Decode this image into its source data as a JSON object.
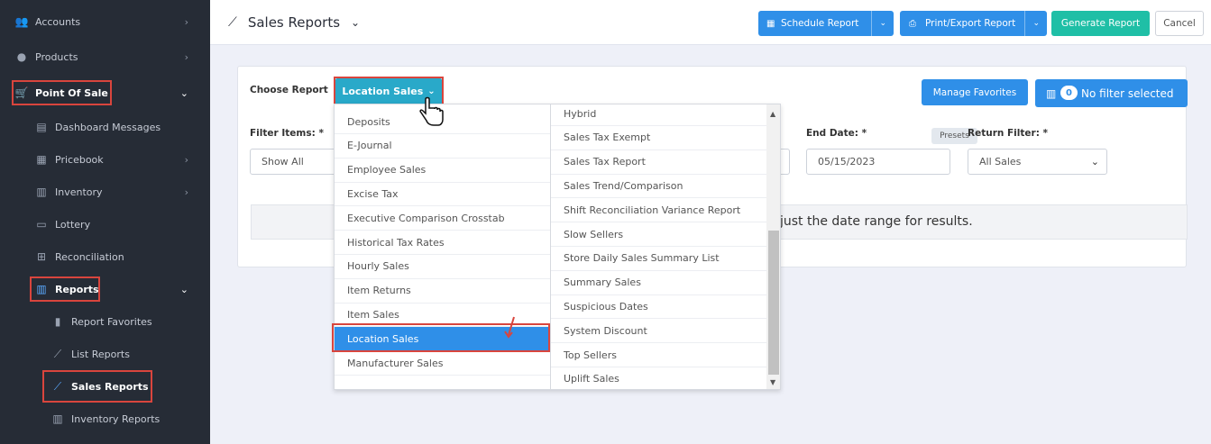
{
  "sidebar": {
    "items": [
      {
        "label": "Accounts",
        "icon": "users-icon",
        "chevron": true
      },
      {
        "label": "Products",
        "icon": "products-icon",
        "chevron": true
      },
      {
        "label": "Point Of Sale",
        "icon": "cart-icon",
        "chevron": true
      },
      {
        "label": "Dashboard Messages",
        "icon": "messages-icon",
        "chevron": false
      },
      {
        "label": "Pricebook",
        "icon": "calculator-icon",
        "chevron": true
      },
      {
        "label": "Inventory",
        "icon": "inventory-icon",
        "chevron": true
      },
      {
        "label": "Lottery",
        "icon": "ticket-icon",
        "chevron": false
      },
      {
        "label": "Reconciliation",
        "icon": "grid-icon",
        "chevron": false
      },
      {
        "label": "Reports",
        "icon": "bar-chart-icon",
        "chevron": true
      },
      {
        "label": "Report Favorites",
        "icon": "bookmark-icon",
        "chevron": false
      },
      {
        "label": "List Reports",
        "icon": "line-chart-icon",
        "chevron": false
      },
      {
        "label": "Sales Reports",
        "icon": "trend-icon",
        "chevron": false
      },
      {
        "label": "Inventory Reports",
        "icon": "inventory-icon",
        "chevron": false
      }
    ]
  },
  "header": {
    "title": "Sales Reports",
    "buttons": {
      "schedule": "Schedule Report",
      "print": "Print/Export Report",
      "generate": "Generate Report",
      "cancel": "Cancel"
    }
  },
  "card": {
    "choose_label": "Choose Report",
    "selected_report": "Location Sales",
    "manage_favorites": "Manage Favorites",
    "filter_count": "0",
    "filter_text": "No filter selected",
    "filter_items_label": "Filter Items: *",
    "filter_items_value": "Show All",
    "end_date_label": "End Date: *",
    "presets": "Presets",
    "end_date_value": "05/15/2023",
    "return_filter_label": "Return Filter: *",
    "return_filter_value": "All Sales",
    "message": "just the date range for results."
  },
  "dropdown": {
    "left": [
      "Deposits",
      "E-Journal",
      "Employee Sales",
      "Excise Tax",
      "Executive Comparison Crosstab",
      "Historical Tax Rates",
      "Hourly Sales",
      "Item Returns",
      "Item Sales",
      "Location Sales",
      "Manufacturer Sales"
    ],
    "right": [
      "Hybrid",
      "Sales Tax Exempt",
      "Sales Tax Report",
      "Sales Trend/Comparison",
      "Shift Reconciliation Variance Report",
      "Slow Sellers",
      "Store Daily Sales Summary List",
      "Summary Sales",
      "Suspicious Dates",
      "System Discount",
      "Top Sellers",
      "Uplift Sales"
    ],
    "selected": "Location Sales"
  },
  "colors": {
    "sidebar_bg": "#262c36",
    "primary": "#2f8fe8",
    "teal": "#1fbfa6",
    "choose": "#29a9c9",
    "highlight": "#d9453d"
  }
}
